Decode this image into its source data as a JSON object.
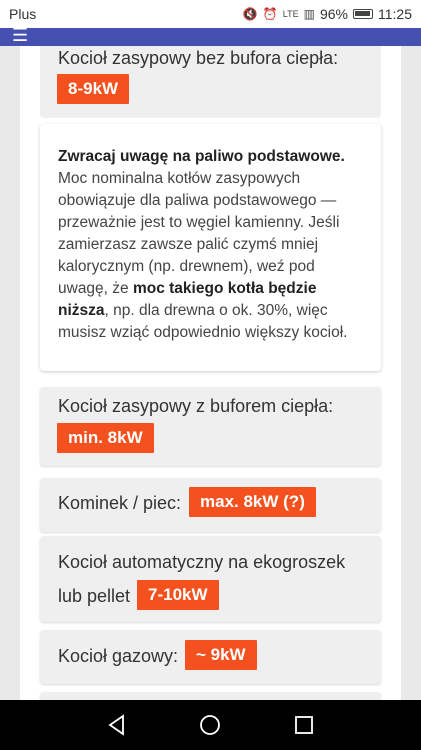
{
  "status_bar": {
    "carrier": "Plus",
    "network": "LTE",
    "battery": "96%",
    "time": "11:25",
    "icons": [
      "mute-icon",
      "alarm-icon",
      "signal-icon",
      "battery-icon"
    ]
  },
  "app_bar": {
    "icon": "menu-icon"
  },
  "cards": {
    "boiler_no_buffer": {
      "title": "Kocioł zasypowy bez bufora ciepła:",
      "value": "8-9kW"
    },
    "note": {
      "heading": "Zwracaj uwagę na paliwo podstawowe.",
      "text_1": " Moc nominalna kotłów zasypowych obowiązuje dla paliwa podstawowego — przeważnie jest to węgiel kamienny. Jeśli zamierzasz zawsze palić czymś mniej kalorycznym (np. drewnem), weź pod uwagę, że ",
      "text_bold": "moc takiego kotła będzie niższa",
      "text_2": ", np. dla drewna o ok. 30%, więc musisz wziąć odpowiednio większy kocioł."
    },
    "boiler_buffer": {
      "title": "Kocioł zasypowy z buforem ciepła:",
      "value": "min. 8kW"
    },
    "fireplace": {
      "title": "Kominek / piec:",
      "value": "max. 8kW (?)"
    },
    "automatic": {
      "title_line1": "Kocioł automatyczny na ekogroszek",
      "title_line2": "lub pellet",
      "value": "7-10kW"
    },
    "gas": {
      "title": "Kocioł gazowy:",
      "value": "~ 9kW"
    }
  },
  "colors": {
    "accent": "#f4511e",
    "app_bar": "#4650b0",
    "card": "#efefef"
  },
  "nav": {
    "back": "back-icon",
    "home": "home-icon",
    "recent": "recent-apps-icon"
  }
}
